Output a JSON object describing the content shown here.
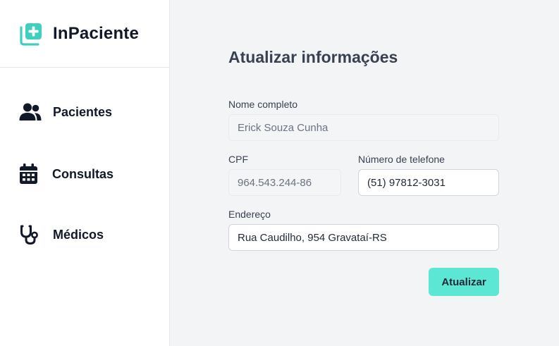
{
  "app": {
    "name": "InPaciente",
    "logo_icon": "hospital-card-plus-icon",
    "accent_color": "#3ecfbd"
  },
  "sidebar": {
    "items": [
      {
        "label": "Pacientes",
        "icon": "users-icon"
      },
      {
        "label": "Consultas",
        "icon": "calendar-icon"
      },
      {
        "label": "Médicos",
        "icon": "stethoscope-icon"
      }
    ]
  },
  "form": {
    "title": "Atualizar informações",
    "fields": {
      "nome": {
        "label": "Nome completo",
        "value": "Erick Souza Cunha",
        "disabled": true
      },
      "cpf": {
        "label": "CPF",
        "value": "964.543.244-86",
        "disabled": true
      },
      "telefone": {
        "label": "Número de telefone",
        "value": "(51) 97812-3031",
        "disabled": false
      },
      "endereco": {
        "label": "Endereço",
        "value": "Rua Caudilho, 954 Gravataí-RS",
        "disabled": false
      }
    },
    "submit_label": "Atualizar",
    "submit_color": "#5ce6d4"
  }
}
